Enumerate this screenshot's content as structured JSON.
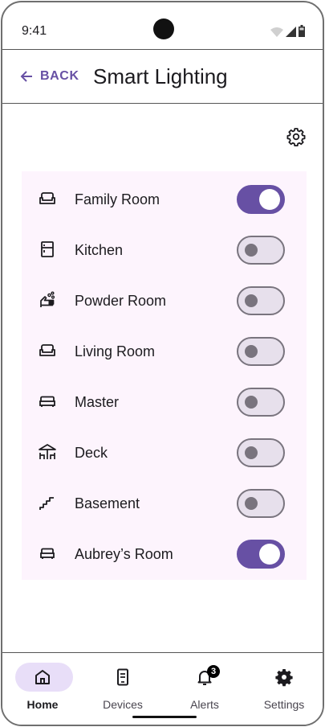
{
  "status_bar": {
    "time": "9:41"
  },
  "app_bar": {
    "back_label": "BACK",
    "title": "Smart Lighting"
  },
  "rooms": [
    {
      "name": "Family Room",
      "icon": "sofa-icon",
      "on": true
    },
    {
      "name": "Kitchen",
      "icon": "fridge-icon",
      "on": false
    },
    {
      "name": "Powder Room",
      "icon": "soap-hand-icon",
      "on": false
    },
    {
      "name": "Living Room",
      "icon": "sofa-icon",
      "on": false
    },
    {
      "name": "Master",
      "icon": "bed-icon",
      "on": false
    },
    {
      "name": "Deck",
      "icon": "deck-icon",
      "on": false
    },
    {
      "name": "Basement",
      "icon": "stairs-icon",
      "on": false
    },
    {
      "name": "Aubrey’s Room",
      "icon": "bed-icon",
      "on": true
    }
  ],
  "nav": {
    "items": [
      {
        "label": "Home",
        "icon": "home-icon",
        "active": true
      },
      {
        "label": "Devices",
        "icon": "tablet-icon",
        "active": false
      },
      {
        "label": "Alerts",
        "icon": "bell-icon",
        "active": false,
        "badge": "3"
      },
      {
        "label": "Settings",
        "icon": "gear-icon",
        "active": false
      }
    ]
  },
  "colors": {
    "accent": "#6750a4",
    "card_bg": "#fdf4fd",
    "active_pill": "#e8def8"
  }
}
